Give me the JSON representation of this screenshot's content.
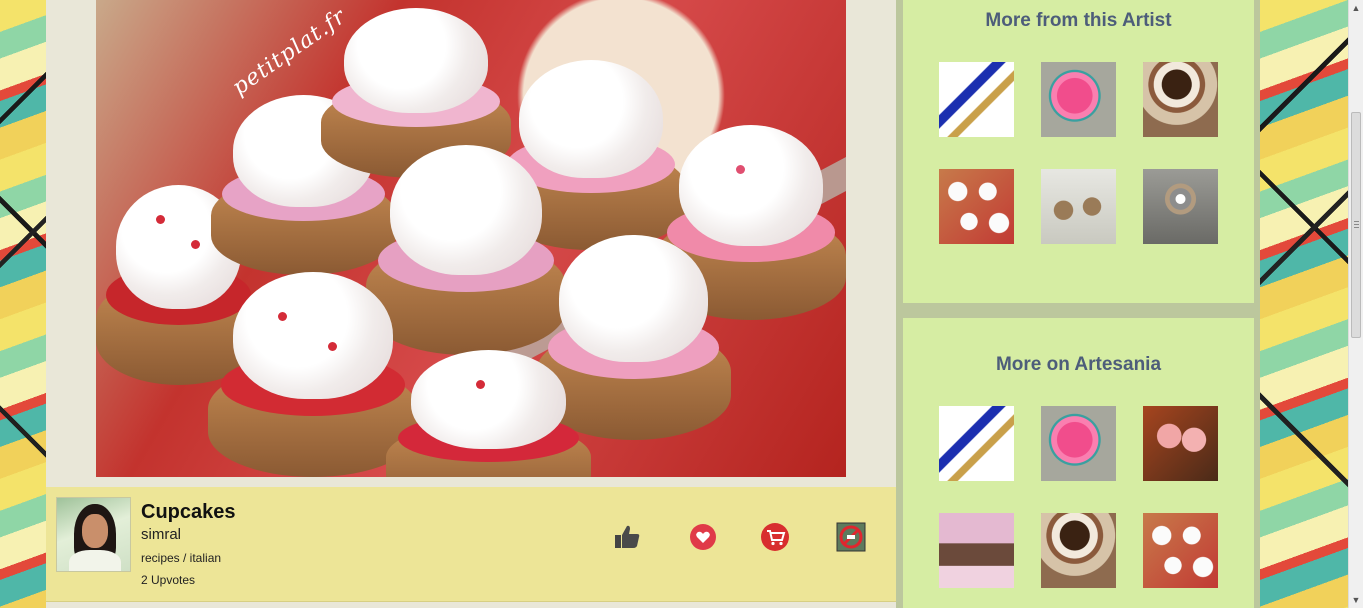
{
  "artwork": {
    "watermark": "petitplat.fr",
    "title": "Cupcakes",
    "artist": "simral",
    "category": "recipes / italian",
    "upvotes": "2 Upvotes"
  },
  "actions": {
    "upvote": "thumbs-up-icon",
    "like": "heart-icon",
    "cart": "cart-icon",
    "flag": "no-entry-icon"
  },
  "sidebar": {
    "artist_section_title": "More from this Artist",
    "artesania_section_title": "More on Artesania",
    "artist_thumbs": [
      "necklace",
      "pink-pony",
      "cake-slice",
      "cupcakes",
      "earrings",
      "owl-pendant"
    ],
    "artesania_thumbs": [
      "necklace",
      "pink-pony",
      "heart-lollipops",
      "jewelry-stand",
      "cake-slice",
      "cupcakes"
    ]
  },
  "colors": {
    "info_bar": "#ede597",
    "panel": "#d6eda3",
    "panel_title": "#4d5d7a",
    "accent_red": "#e03a48"
  }
}
